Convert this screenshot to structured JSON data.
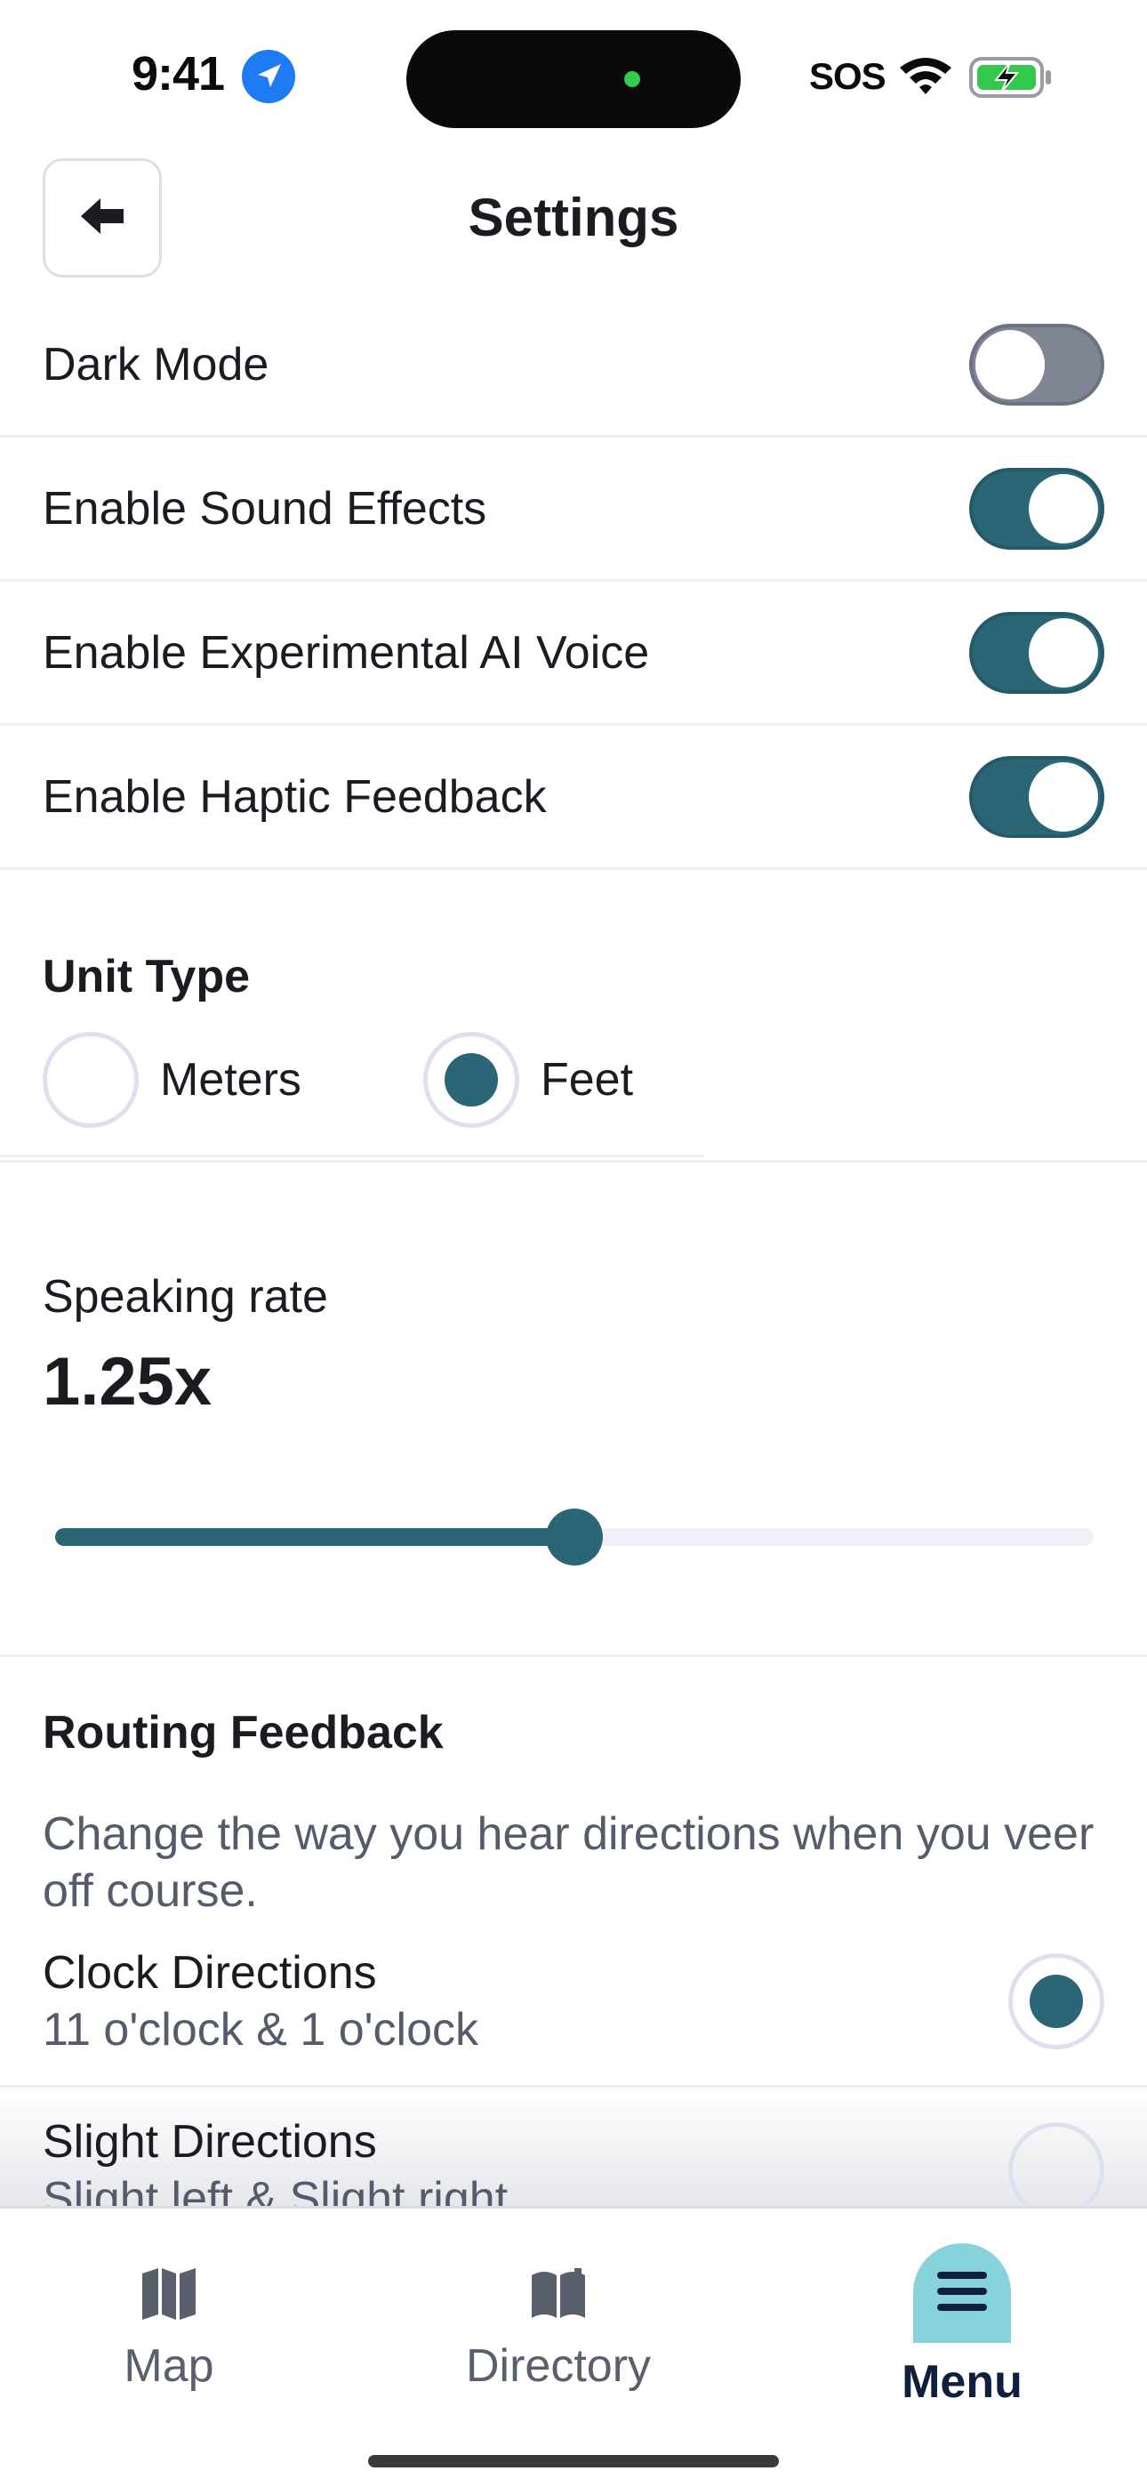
{
  "status_bar": {
    "time": "9:41",
    "sos": "SOS",
    "icons": [
      "location-arrow-icon",
      "wifi-icon",
      "battery-charging-icon"
    ]
  },
  "header": {
    "title": "Settings",
    "back_icon": "arrow-left-icon"
  },
  "toggles": [
    {
      "label": "Dark Mode",
      "on": false
    },
    {
      "label": "Enable Sound Effects",
      "on": true
    },
    {
      "label": "Enable Experimental AI Voice",
      "on": true
    },
    {
      "label": "Enable Haptic Feedback",
      "on": true
    }
  ],
  "unit_type": {
    "heading": "Unit Type",
    "options": [
      {
        "label": "Meters",
        "selected": false
      },
      {
        "label": "Feet",
        "selected": true
      }
    ]
  },
  "speaking_rate": {
    "label": "Speaking rate",
    "value_text": "1.25x",
    "slider_fraction": 0.5
  },
  "routing_feedback": {
    "heading": "Routing Feedback",
    "description": "Change the way you hear directions when you veer off course.",
    "options": [
      {
        "title": "Clock Directions",
        "subtitle": "11 o'clock & 1 o'clock",
        "selected": true
      },
      {
        "title": "Slight Directions",
        "subtitle": "Slight left & Slight right",
        "selected": false
      }
    ]
  },
  "tabbar": {
    "tabs": [
      {
        "label": "Map",
        "icon": "map-icon",
        "active": false
      },
      {
        "label": "Directory",
        "icon": "book-open-icon",
        "active": false
      },
      {
        "label": "Menu",
        "icon": "menu-icon",
        "active": true
      }
    ]
  },
  "colors": {
    "accent": "#2a6676",
    "toggle_off": "#7f8593",
    "menu_highlight": "#86d3dc",
    "location_blue": "#1f7bf2",
    "battery_green": "#32c94d"
  }
}
